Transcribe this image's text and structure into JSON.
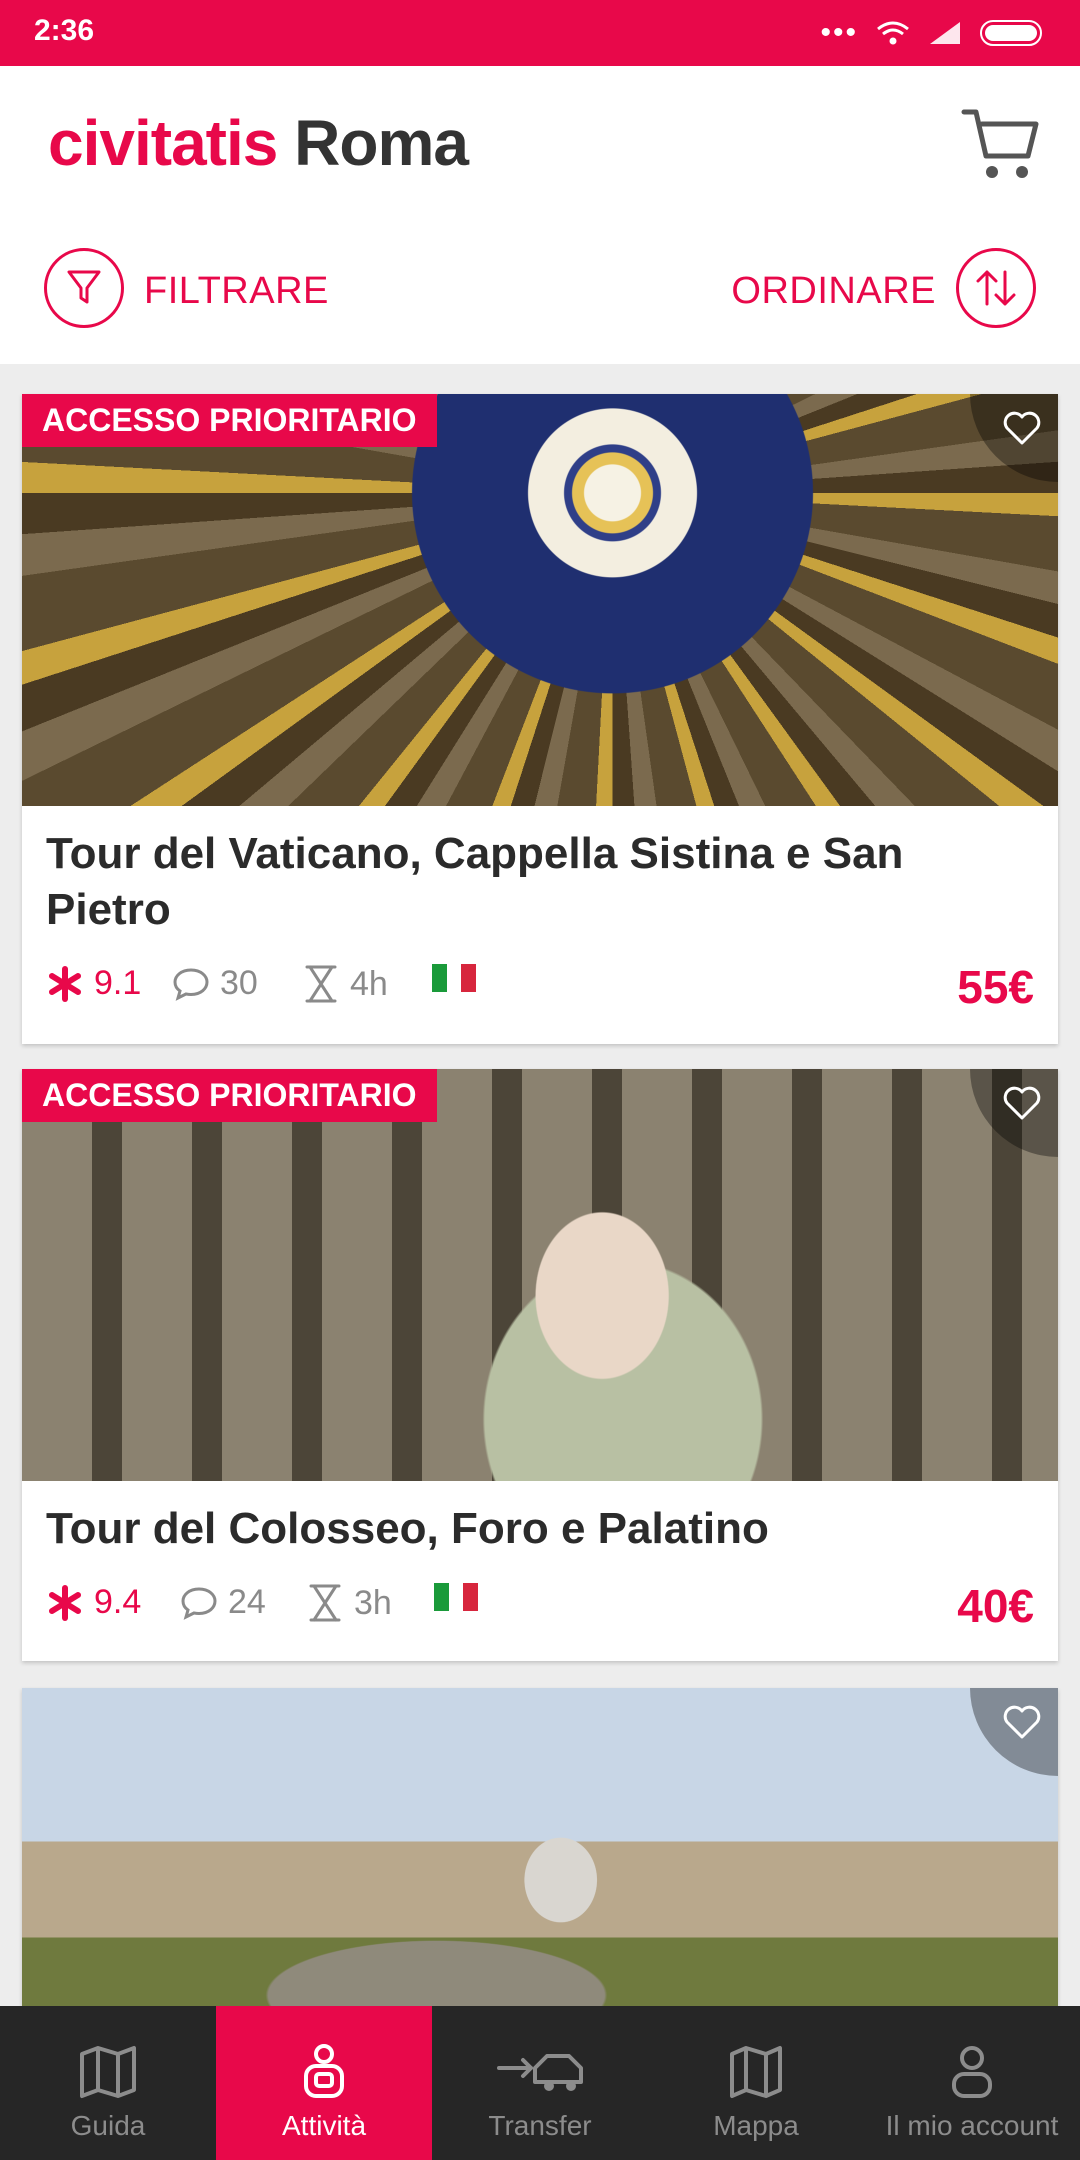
{
  "status_bar": {
    "time": "2:36"
  },
  "header": {
    "brand": "civitatis",
    "city": "Roma"
  },
  "actions": {
    "filter_label": "FILTRARE",
    "sort_label": "ORDINARE"
  },
  "cards": [
    {
      "badge": "ACCESSO PRIORITARIO",
      "title": "Tour del Vaticano, Cappella Sistina e San Pietro",
      "rating": "9.1",
      "reviews": "30",
      "duration": "4h",
      "price": "55€"
    },
    {
      "badge": "ACCESSO PRIORITARIO",
      "title": "Tour del Colosseo, Foro e Palatino",
      "rating": "9.4",
      "reviews": "24",
      "duration": "3h",
      "price": "40€"
    },
    {
      "badge": "",
      "title": "",
      "rating": "",
      "reviews": "",
      "duration": "",
      "price": ""
    }
  ],
  "nav": [
    {
      "label": "Guida",
      "icon": "map-book-icon"
    },
    {
      "label": "Attività",
      "icon": "activities-icon",
      "active": true
    },
    {
      "label": "Transfer",
      "icon": "transfer-icon"
    },
    {
      "label": "Mappa",
      "icon": "map-icon"
    },
    {
      "label": "Il mio account",
      "icon": "account-icon"
    }
  ],
  "colors": {
    "brand": "#e8084a",
    "nav_bg": "#262626"
  }
}
